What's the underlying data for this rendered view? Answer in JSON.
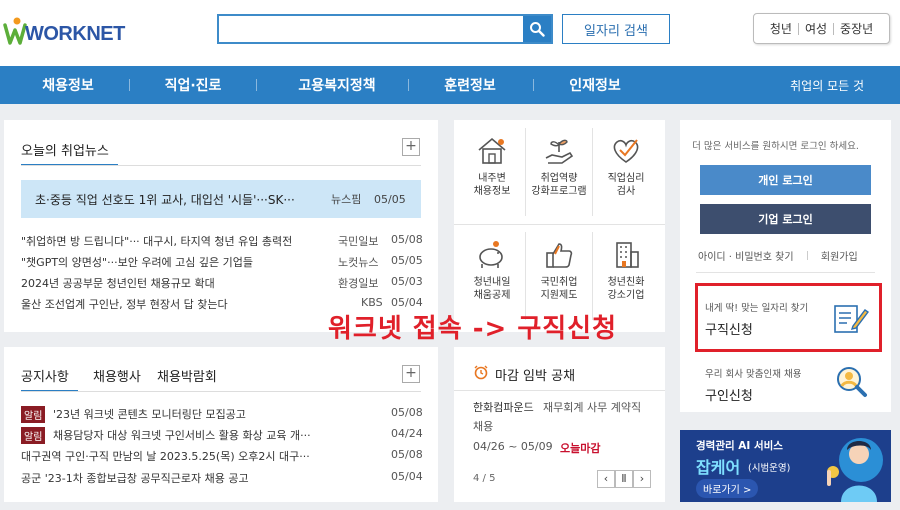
{
  "header": {
    "logo_text": "WORKNET",
    "search": {
      "value": "",
      "placeholder": ""
    },
    "job_search_label": "일자리 검색",
    "audience": [
      "청년",
      "여성",
      "중장년"
    ]
  },
  "nav": {
    "items": [
      "채용정보",
      "직업·진로",
      "고용복지정책",
      "훈련정보",
      "인재정보"
    ],
    "all_label": "취업의 모든 것"
  },
  "news": {
    "tab": "오늘의 취업뉴스",
    "highlight": {
      "title": "초·중등 직업 선호도 1위 교사, 대입선 '시들'···SK···",
      "source": "뉴스핌",
      "date": "05/05"
    },
    "rows": [
      {
        "title": "\"취업하면 방 드립니다\"··· 대구시, 타지역 청년 유입 총력전",
        "source": "국민일보",
        "date": "05/08"
      },
      {
        "title": "\"챗GPT의 양면성\"···보안 우려에 고심 깊은 기업들",
        "source": "노컷뉴스",
        "date": "05/05"
      },
      {
        "title": "2024년 공공부문 청년인턴 채용규모 확대",
        "source": "환경일보",
        "date": "05/03"
      },
      {
        "title": "울산 조선업계 구인난, 정부 현장서 답 찾는다",
        "source": "KBS",
        "date": "05/04"
      }
    ]
  },
  "notice": {
    "tabs": [
      "공지사항",
      "채용행사",
      "채용박람회"
    ],
    "rows": [
      {
        "badge": "알림",
        "title": "'23년 워크넷 콘텐츠 모니터링단 모집공고",
        "date": "05/08"
      },
      {
        "badge": "알림",
        "title": "채용담당자 대상 워크넷 구인서비스 활용 화상 교육 개···",
        "date": "04/24"
      },
      {
        "badge": "",
        "title": "대구권역 구인·구직 만남의 날 2023.5.25(목) 오후2시 대구···",
        "date": "05/08"
      },
      {
        "badge": "",
        "title": "공군 '23-1차 종합보급창 공무직근로자 채용 공고",
        "date": "05/04"
      }
    ]
  },
  "services": [
    {
      "label": "내주변\n채용정보",
      "icon": "house-icon"
    },
    {
      "label": "취업역량\n강화프로그램",
      "icon": "sprout-hand-icon"
    },
    {
      "label": "직업심리\n검사",
      "icon": "heart-check-icon"
    },
    {
      "label": "청년내일\n채움공제",
      "icon": "piggy-bank-icon"
    },
    {
      "label": "국민취업\n지원제도",
      "icon": "thumbs-up-icon"
    },
    {
      "label": "청년친화\n강소기업",
      "icon": "buildings-icon"
    }
  ],
  "deadline": {
    "title": "마감 임박 공채",
    "company": "한화컴파운드",
    "job": "재무회계 사무 계약직",
    "job_line2": "채용",
    "period": "04/26 ~ 05/09",
    "status": "오늘마감",
    "page": "4 / 5"
  },
  "login": {
    "note": "더 많은 서비스를 원하시면 로그인 하세요.",
    "personal_label": "개인 로그인",
    "company_label": "기업 로그인",
    "find_label": "아이디 · 비밀번호 찾기",
    "join_label": "회원가입"
  },
  "quick": {
    "job_seek_sub": "내게 딱! 맞는 일자리 찾기",
    "job_seek_title": "구직신청",
    "recruit_sub": "우리 회사 맞춤인재 채용",
    "recruit_title": "구인신청"
  },
  "annotation": "워크넷 접속 -> 구직신청",
  "banner": {
    "line1": "경력관리 AI 서비스",
    "brand": "잡케어",
    "brand_sub": "(시범운영)",
    "cta": "바로가기 >"
  },
  "colors": {
    "brand_blue": "#2b7fc4",
    "login_personal": "#4a8ac9",
    "login_company": "#3d4e6e",
    "notice_badge": "#8a1c24",
    "annotation_red": "#e0202a",
    "deadline_red": "#c8102e"
  }
}
